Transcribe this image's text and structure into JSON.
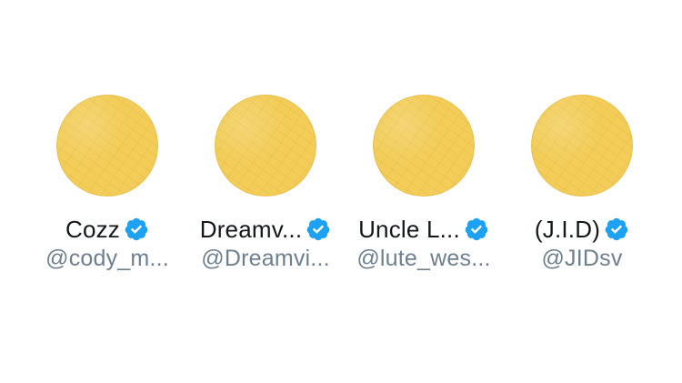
{
  "suggestions": [
    {
      "name": "Cozz",
      "handle": "@cody_m...",
      "verified": true,
      "avatar_color": "#F3CD58"
    },
    {
      "name": "Dreamv...",
      "handle": "@Dreamvi...",
      "verified": true,
      "avatar_color": "#F3CD58"
    },
    {
      "name": "Uncle L...",
      "handle": "@lute_wes...",
      "verified": true,
      "avatar_color": "#F3CD58"
    },
    {
      "name": "(J.I.D)",
      "handle": "@JIDsv",
      "verified": true,
      "avatar_color": "#F3CD58"
    }
  ],
  "colors": {
    "verified_badge": "#1DA1F2",
    "name_text": "#14171A",
    "handle_text": "#6E7F8E"
  },
  "icons": {
    "verified": "verified-badge-icon"
  }
}
